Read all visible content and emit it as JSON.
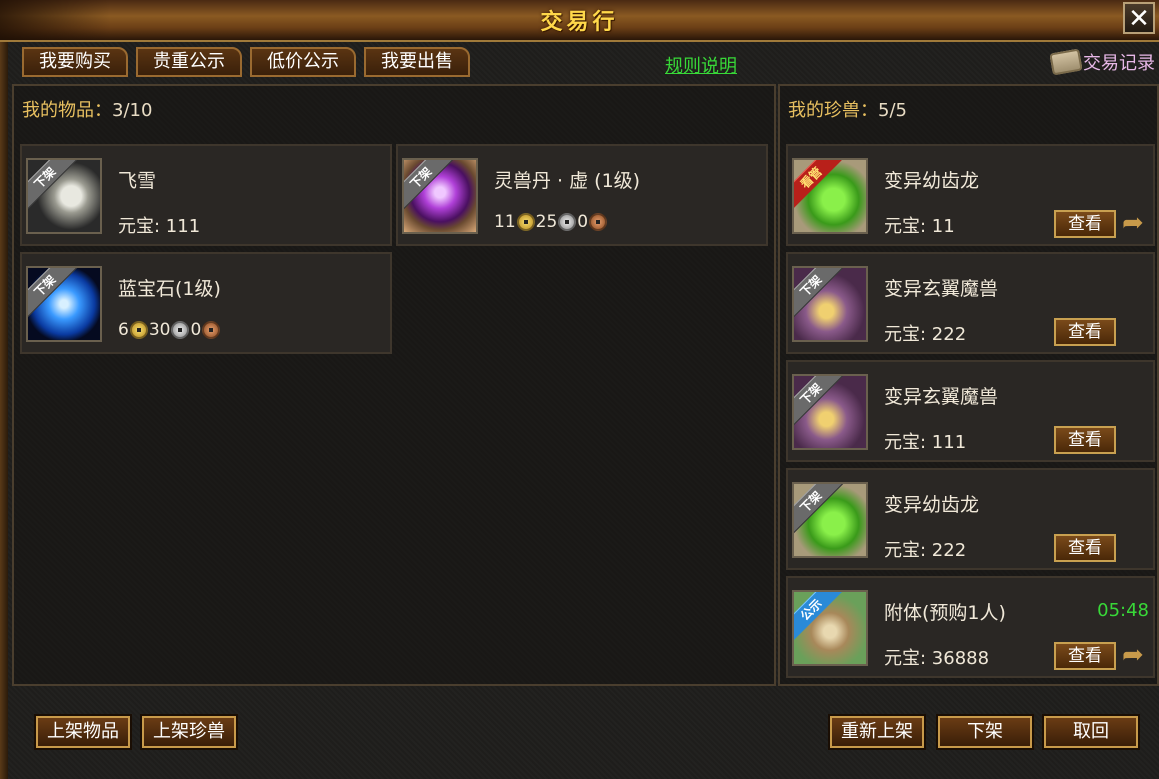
{
  "window": {
    "title": "交易行",
    "close_label": "✕"
  },
  "tabs": [
    {
      "label": "我要购买"
    },
    {
      "label": "贵重公示"
    },
    {
      "label": "低价公示"
    },
    {
      "label": "我要出售"
    }
  ],
  "rules_link": "规则说明",
  "trade_record": "交易记录",
  "my_items": {
    "label": "我的物品：",
    "count": "3/10",
    "items": [
      {
        "name": "飞雪",
        "price_label": "元宝: 111",
        "status": "下架"
      },
      {
        "name": "灵兽丹 · 虚 (1级)",
        "status": "下架",
        "coins": {
          "gold": "11",
          "silver": "25",
          "copper": "0"
        }
      },
      {
        "name": "蓝宝石(1级)",
        "status": "下架",
        "coins": {
          "gold": "6",
          "silver": "30",
          "copper": "0"
        }
      }
    ]
  },
  "my_pets": {
    "label": "我的珍兽：",
    "count": "5/5",
    "pets": [
      {
        "name": "变异幼齿龙",
        "price_label": "元宝: 11",
        "status": "看管",
        "view": "查看"
      },
      {
        "name": "变异玄翼魔兽",
        "price_label": "元宝: 222",
        "status": "下架",
        "view": "查看"
      },
      {
        "name": "变异玄翼魔兽",
        "price_label": "元宝: 111",
        "status": "下架",
        "view": "查看"
      },
      {
        "name": "变异幼齿龙",
        "price_label": "元宝: 222",
        "status": "下架",
        "view": "查看"
      },
      {
        "name": "附体(预购1人)",
        "price_label": "元宝: 36888",
        "status": "公示",
        "view": "查看",
        "timer": "05:48"
      }
    ]
  },
  "bottom": {
    "list_item": "上架物品",
    "list_pet": "上架珍兽",
    "relist": "重新上架",
    "delist": "下架",
    "retrieve": "取回"
  }
}
